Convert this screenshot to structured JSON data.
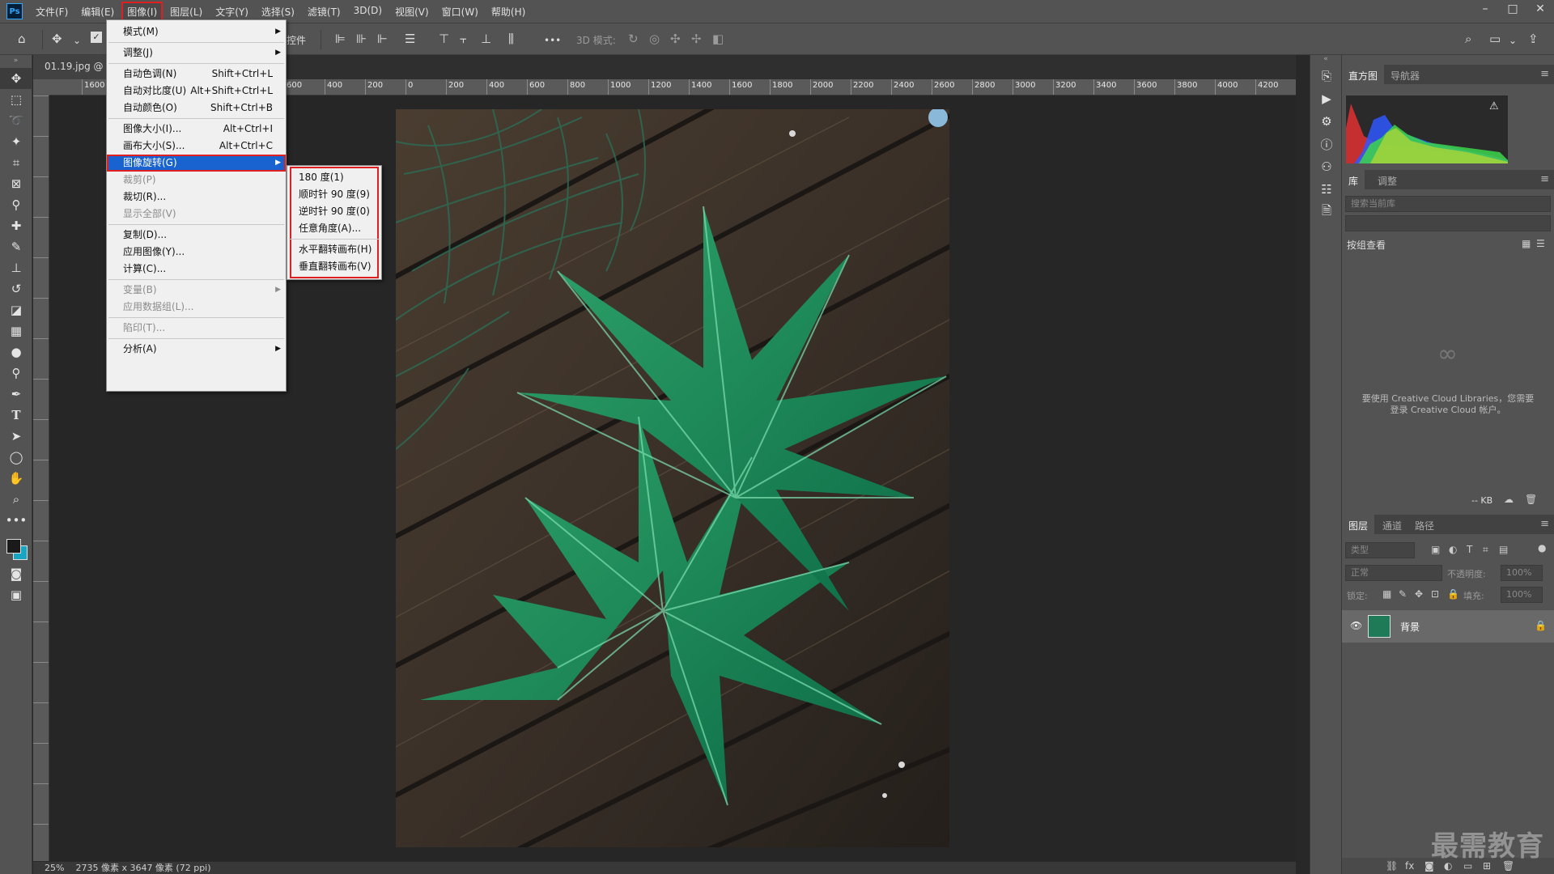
{
  "app": {
    "logo": "Ps"
  },
  "menubar": {
    "items": [
      "文件(F)",
      "编辑(E)",
      "图像(I)",
      "图层(L)",
      "文字(Y)",
      "选择(S)",
      "滤镜(T)",
      "3D(D)",
      "视图(V)",
      "窗口(W)",
      "帮助(H)"
    ],
    "active_index": 2
  },
  "window_controls": {
    "minimize": "–",
    "maximize": "□",
    "close": "✕"
  },
  "options_bar": {
    "controls_label": "控件",
    "mode_3d_label": "3D 模式:",
    "more": "•••"
  },
  "document": {
    "tab_title": "01.19.jpg @ 25% (RGB/8#)",
    "zoom": "25%",
    "info": "2735 像素 x 3647 像素 (72 ppi)"
  },
  "ruler": {
    "h_labels": [
      "0",
      "1600",
      "1400",
      "1200",
      "1000",
      "800",
      "600",
      "400",
      "200",
      "0",
      "200",
      "400",
      "600",
      "800",
      "1000",
      "1200",
      "1400",
      "1600",
      "1800",
      "2000",
      "2200",
      "2400",
      "2600",
      "2800",
      "3000",
      "3200",
      "3400",
      "3600",
      "3800",
      "4000",
      "4200",
      "4"
    ]
  },
  "image_menu": {
    "items": [
      {
        "label": "模式(M)",
        "shortcut": "",
        "submenu": true,
        "disabled": false
      },
      {
        "sep": true
      },
      {
        "label": "调整(J)",
        "shortcut": "",
        "submenu": true,
        "disabled": false
      },
      {
        "sep": true
      },
      {
        "label": "自动色调(N)",
        "shortcut": "Shift+Ctrl+L",
        "submenu": false,
        "disabled": false
      },
      {
        "label": "自动对比度(U)",
        "shortcut": "Alt+Shift+Ctrl+L",
        "submenu": false,
        "disabled": false
      },
      {
        "label": "自动颜色(O)",
        "shortcut": "Shift+Ctrl+B",
        "submenu": false,
        "disabled": false
      },
      {
        "sep": true
      },
      {
        "label": "图像大小(I)...",
        "shortcut": "Alt+Ctrl+I",
        "submenu": false,
        "disabled": false
      },
      {
        "label": "画布大小(S)...",
        "shortcut": "Alt+Ctrl+C",
        "submenu": false,
        "disabled": false
      },
      {
        "label": "图像旋转(G)",
        "shortcut": "",
        "submenu": true,
        "disabled": false,
        "highlight": true
      },
      {
        "label": "裁剪(P)",
        "shortcut": "",
        "submenu": false,
        "disabled": true
      },
      {
        "label": "裁切(R)...",
        "shortcut": "",
        "submenu": false,
        "disabled": false
      },
      {
        "label": "显示全部(V)",
        "shortcut": "",
        "submenu": false,
        "disabled": true
      },
      {
        "sep": true
      },
      {
        "label": "复制(D)...",
        "shortcut": "",
        "submenu": false,
        "disabled": false
      },
      {
        "label": "应用图像(Y)...",
        "shortcut": "",
        "submenu": false,
        "disabled": false
      },
      {
        "label": "计算(C)...",
        "shortcut": "",
        "submenu": false,
        "disabled": false
      },
      {
        "sep": true
      },
      {
        "label": "变量(B)",
        "shortcut": "",
        "submenu": true,
        "disabled": true
      },
      {
        "label": "应用数据组(L)...",
        "shortcut": "",
        "submenu": false,
        "disabled": true
      },
      {
        "sep": true
      },
      {
        "label": "陷印(T)...",
        "shortcut": "",
        "submenu": false,
        "disabled": true
      },
      {
        "sep": true
      },
      {
        "label": "分析(A)",
        "shortcut": "",
        "submenu": true,
        "disabled": false
      }
    ]
  },
  "rotate_menu": {
    "items": [
      {
        "label": "180 度(1)"
      },
      {
        "label": "顺时针 90 度(9)"
      },
      {
        "label": "逆时针 90 度(0)"
      },
      {
        "label": "任意角度(A)..."
      },
      {
        "sep": true
      },
      {
        "label": "水平翻转画布(H)"
      },
      {
        "label": "垂直翻转画布(V)"
      }
    ]
  },
  "panels": {
    "histogram": {
      "tabs": [
        "直方图",
        "导航器"
      ],
      "active": 0,
      "warning": "⚠"
    },
    "library": {
      "tabs": [
        "库",
        "调整"
      ],
      "active": 0,
      "search_placeholder": "搜索当前库",
      "group_by": "按组查看",
      "message": "要使用 Creative Cloud Libraries，您需要登录 Creative Cloud 帐户。",
      "size": "-- KB"
    },
    "layers": {
      "tabs": [
        "图层",
        "通道",
        "路径"
      ],
      "active": 0,
      "filter_placeholder": "类型",
      "blend_mode": "正常",
      "opacity_label": "不透明度:",
      "opacity_value": "100%",
      "lock_label": "锁定:",
      "fill_label": "填充:",
      "fill_value": "100%",
      "layer_name": "背景"
    }
  },
  "watermark": "最需教育",
  "colors": {
    "accent_red": "#e02020",
    "menu_highlight": "#1963d0",
    "bg_swatch": "#17a5c3"
  }
}
